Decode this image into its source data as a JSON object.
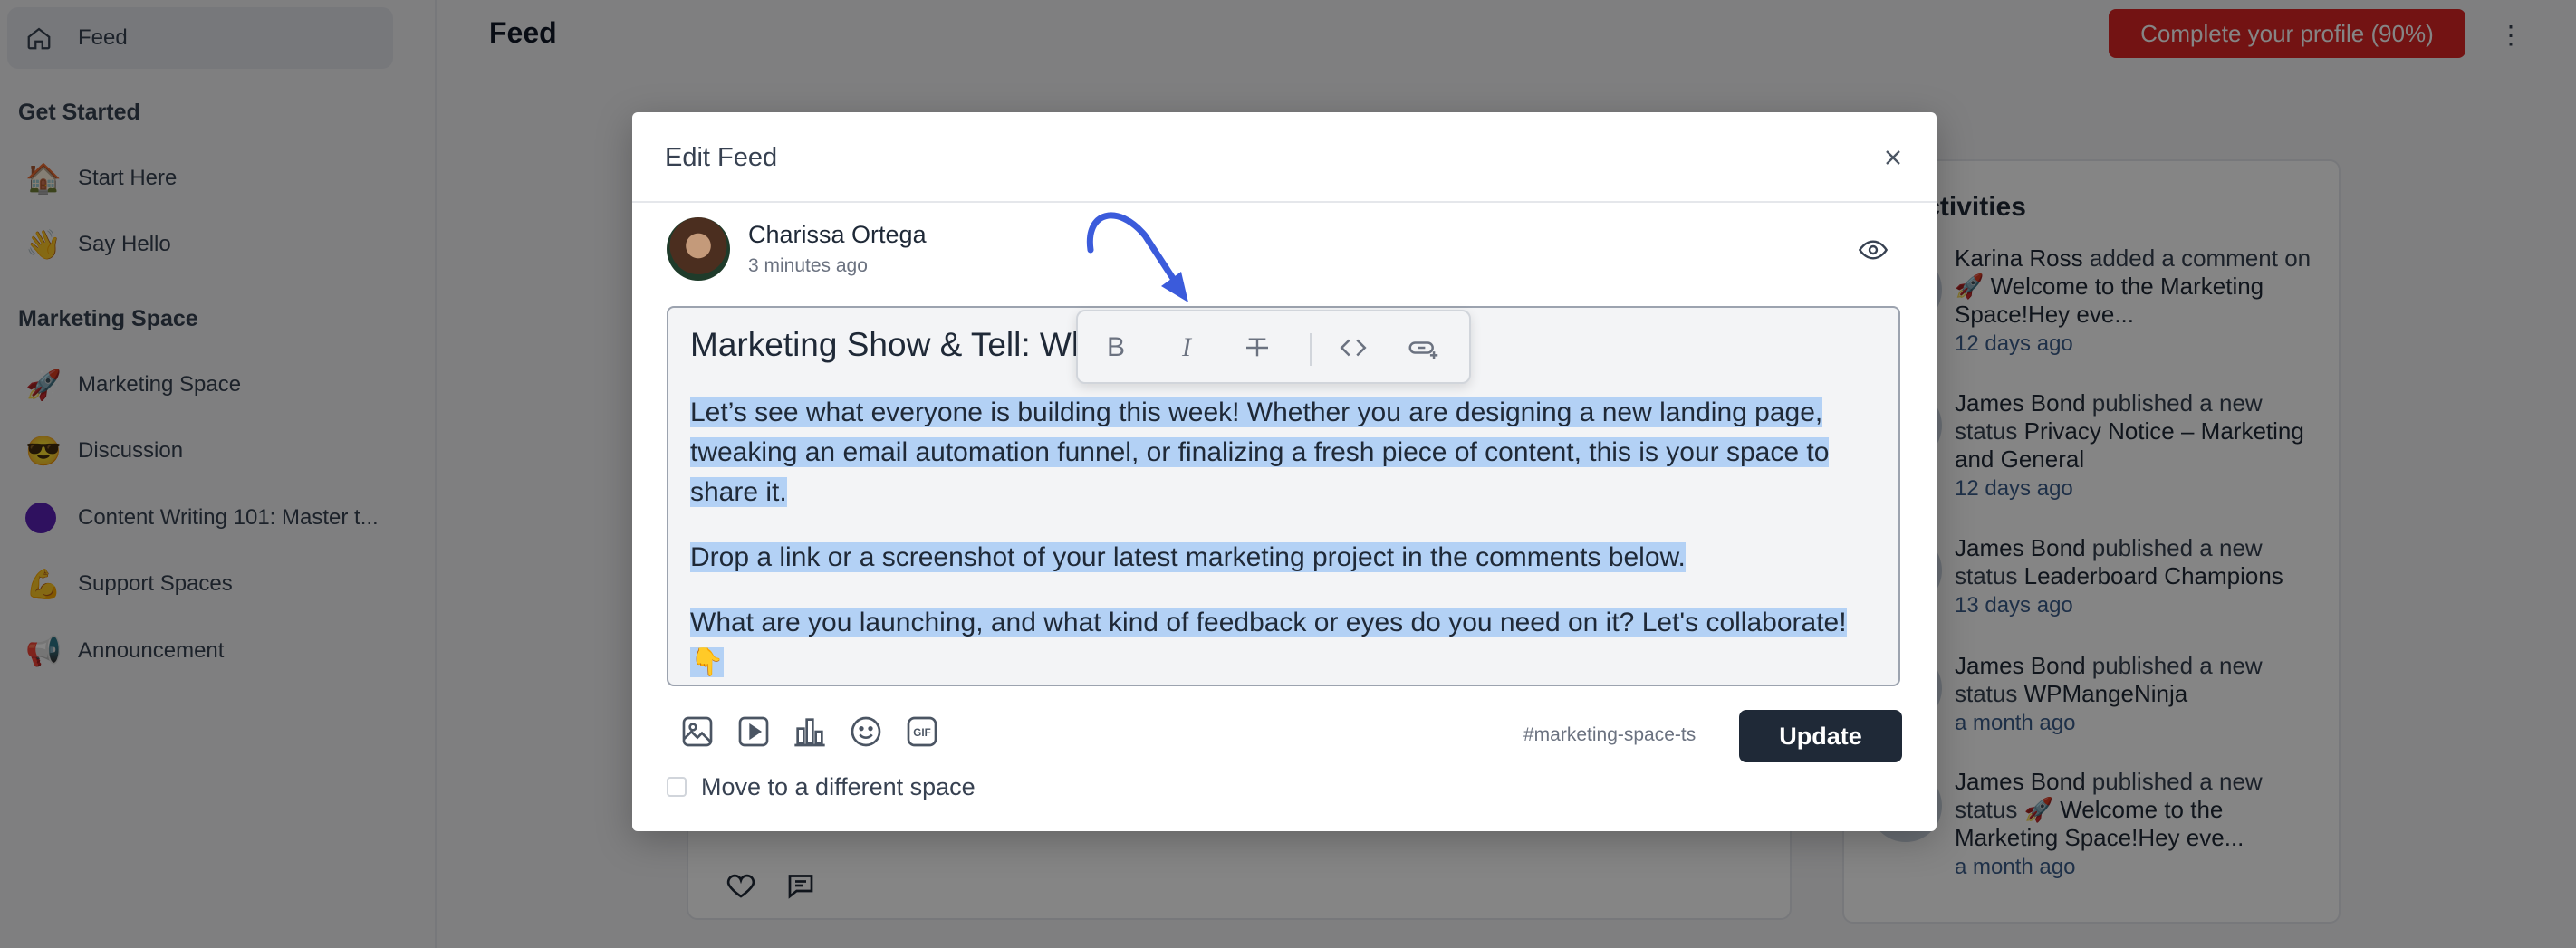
{
  "sidebar": {
    "feed_label": "Feed",
    "get_started_title": "Get Started",
    "get_started": [
      {
        "emoji": "🏠",
        "label": "Start Here"
      },
      {
        "emoji": "👋",
        "label": "Say Hello"
      }
    ],
    "marketing_title": "Marketing Space",
    "marketing": [
      {
        "emoji": "🚀",
        "label": "Marketing Space"
      },
      {
        "emoji": "😎",
        "label": "Discussion"
      },
      {
        "emoji": "",
        "label": "Content Writing 101: Master t..."
      },
      {
        "emoji": "💪",
        "label": "Support Spaces"
      },
      {
        "emoji": "📢",
        "label": "Announcement"
      }
    ]
  },
  "header": {
    "title": "Feed",
    "complete_profile": "Complete your profile (90%)"
  },
  "activities": {
    "title": "nt Activities",
    "items": [
      {
        "actor": "Karina Ross",
        "action": "added a comment on",
        "target": "🚀 Welcome to the Marketing Space!Hey eve...",
        "time": "12 days ago"
      },
      {
        "actor": "James Bond",
        "action": "published a new status",
        "target": "Privacy Notice – Marketing and General",
        "time": "12 days ago"
      },
      {
        "actor": "James Bond",
        "action": "published a new status",
        "target": "Leaderboard Champions",
        "time": "13 days ago"
      },
      {
        "actor": "James Bond",
        "action": "published a new status",
        "target": "WPMangeNinja",
        "time": "a month ago"
      },
      {
        "actor": "James Bond",
        "action": "published a new status",
        "target": "🚀 Welcome to the Marketing Space!Hey eve...",
        "time": "a month ago"
      }
    ]
  },
  "modal": {
    "title": "Edit Feed",
    "author_name": "Charissa Ortega",
    "author_time": "3 minutes ago",
    "post_title": "Marketing Show & Tell: Wh",
    "paragraphs": [
      "Let’s see what everyone is building this week! Whether you are designing a new landing page, tweaking an email automation funnel, or finalizing a fresh piece of content, this is your space to share it.",
      "Drop a link or a screenshot of your latest marketing project in the comments below.",
      "What are you launching, and what kind of feedback or eyes do you need on it? Let's collaborate! 👇"
    ],
    "toolbar": {
      "bold": "B",
      "italic": "I"
    },
    "tag": "#marketing-space-ts",
    "update_label": "Update",
    "move_label": "Move to a different space"
  },
  "colors": {
    "accent_red": "#dc2626",
    "selection": "#b3d1f5",
    "arrow": "#3b5bdb"
  }
}
